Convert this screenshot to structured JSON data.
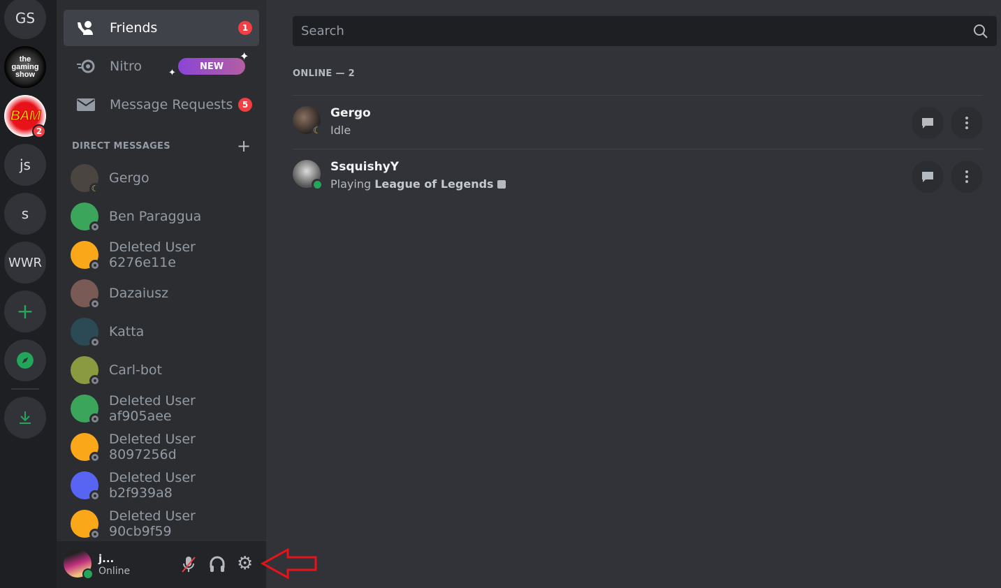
{
  "servers": [
    {
      "label": "GS"
    },
    {
      "label": "",
      "name": "the gaming show"
    },
    {
      "label": "",
      "name": "BAM",
      "badge": "2"
    },
    {
      "label": "js"
    },
    {
      "label": "s"
    },
    {
      "label": "WWR"
    }
  ],
  "nav": {
    "friends": "Friends",
    "friends_badge": "1",
    "nitro": "Nitro",
    "nitro_new": "NEW",
    "message_requests": "Message Requests",
    "message_requests_badge": "5"
  },
  "dm_header": "DIRECT MESSAGES",
  "dms": [
    {
      "name": "Gergo",
      "color": "#4a4540",
      "status": "idle"
    },
    {
      "name": "Ben Paraggua",
      "color": "#3ba55c",
      "status": "offline"
    },
    {
      "name": "Deleted User 6276e11e",
      "color": "#faa81a",
      "status": "offline"
    },
    {
      "name": "Dazaiusz",
      "color": "#7a5a55",
      "status": "offline"
    },
    {
      "name": "Katta",
      "color": "#2c4a55",
      "status": "offline"
    },
    {
      "name": "Carl-bot",
      "color": "#8a9a40",
      "status": "offline"
    },
    {
      "name": "Deleted User af905aee",
      "color": "#3ba55c",
      "status": "offline"
    },
    {
      "name": "Deleted User 8097256d",
      "color": "#faa81a",
      "status": "offline"
    },
    {
      "name": "Deleted User b2f939a8",
      "color": "#5865f2",
      "status": "offline"
    },
    {
      "name": "Deleted User 90cb9f59",
      "color": "#faa81a",
      "status": "offline"
    }
  ],
  "user": {
    "name": "j...",
    "status": "Online"
  },
  "search": {
    "placeholder": "Search"
  },
  "online_header": "ONLINE — 2",
  "friends": [
    {
      "name": "Gergo",
      "status": "Idle",
      "presence": "idle"
    },
    {
      "name": "SsquishyY",
      "status_prefix": "Playing ",
      "status_game": "League of Legends",
      "presence": "online"
    }
  ],
  "colors": {
    "accent": "#5865f2",
    "online": "#23a55a",
    "idle": "#f0b232",
    "danger": "#f23f43",
    "annotation": "#e8121b"
  }
}
